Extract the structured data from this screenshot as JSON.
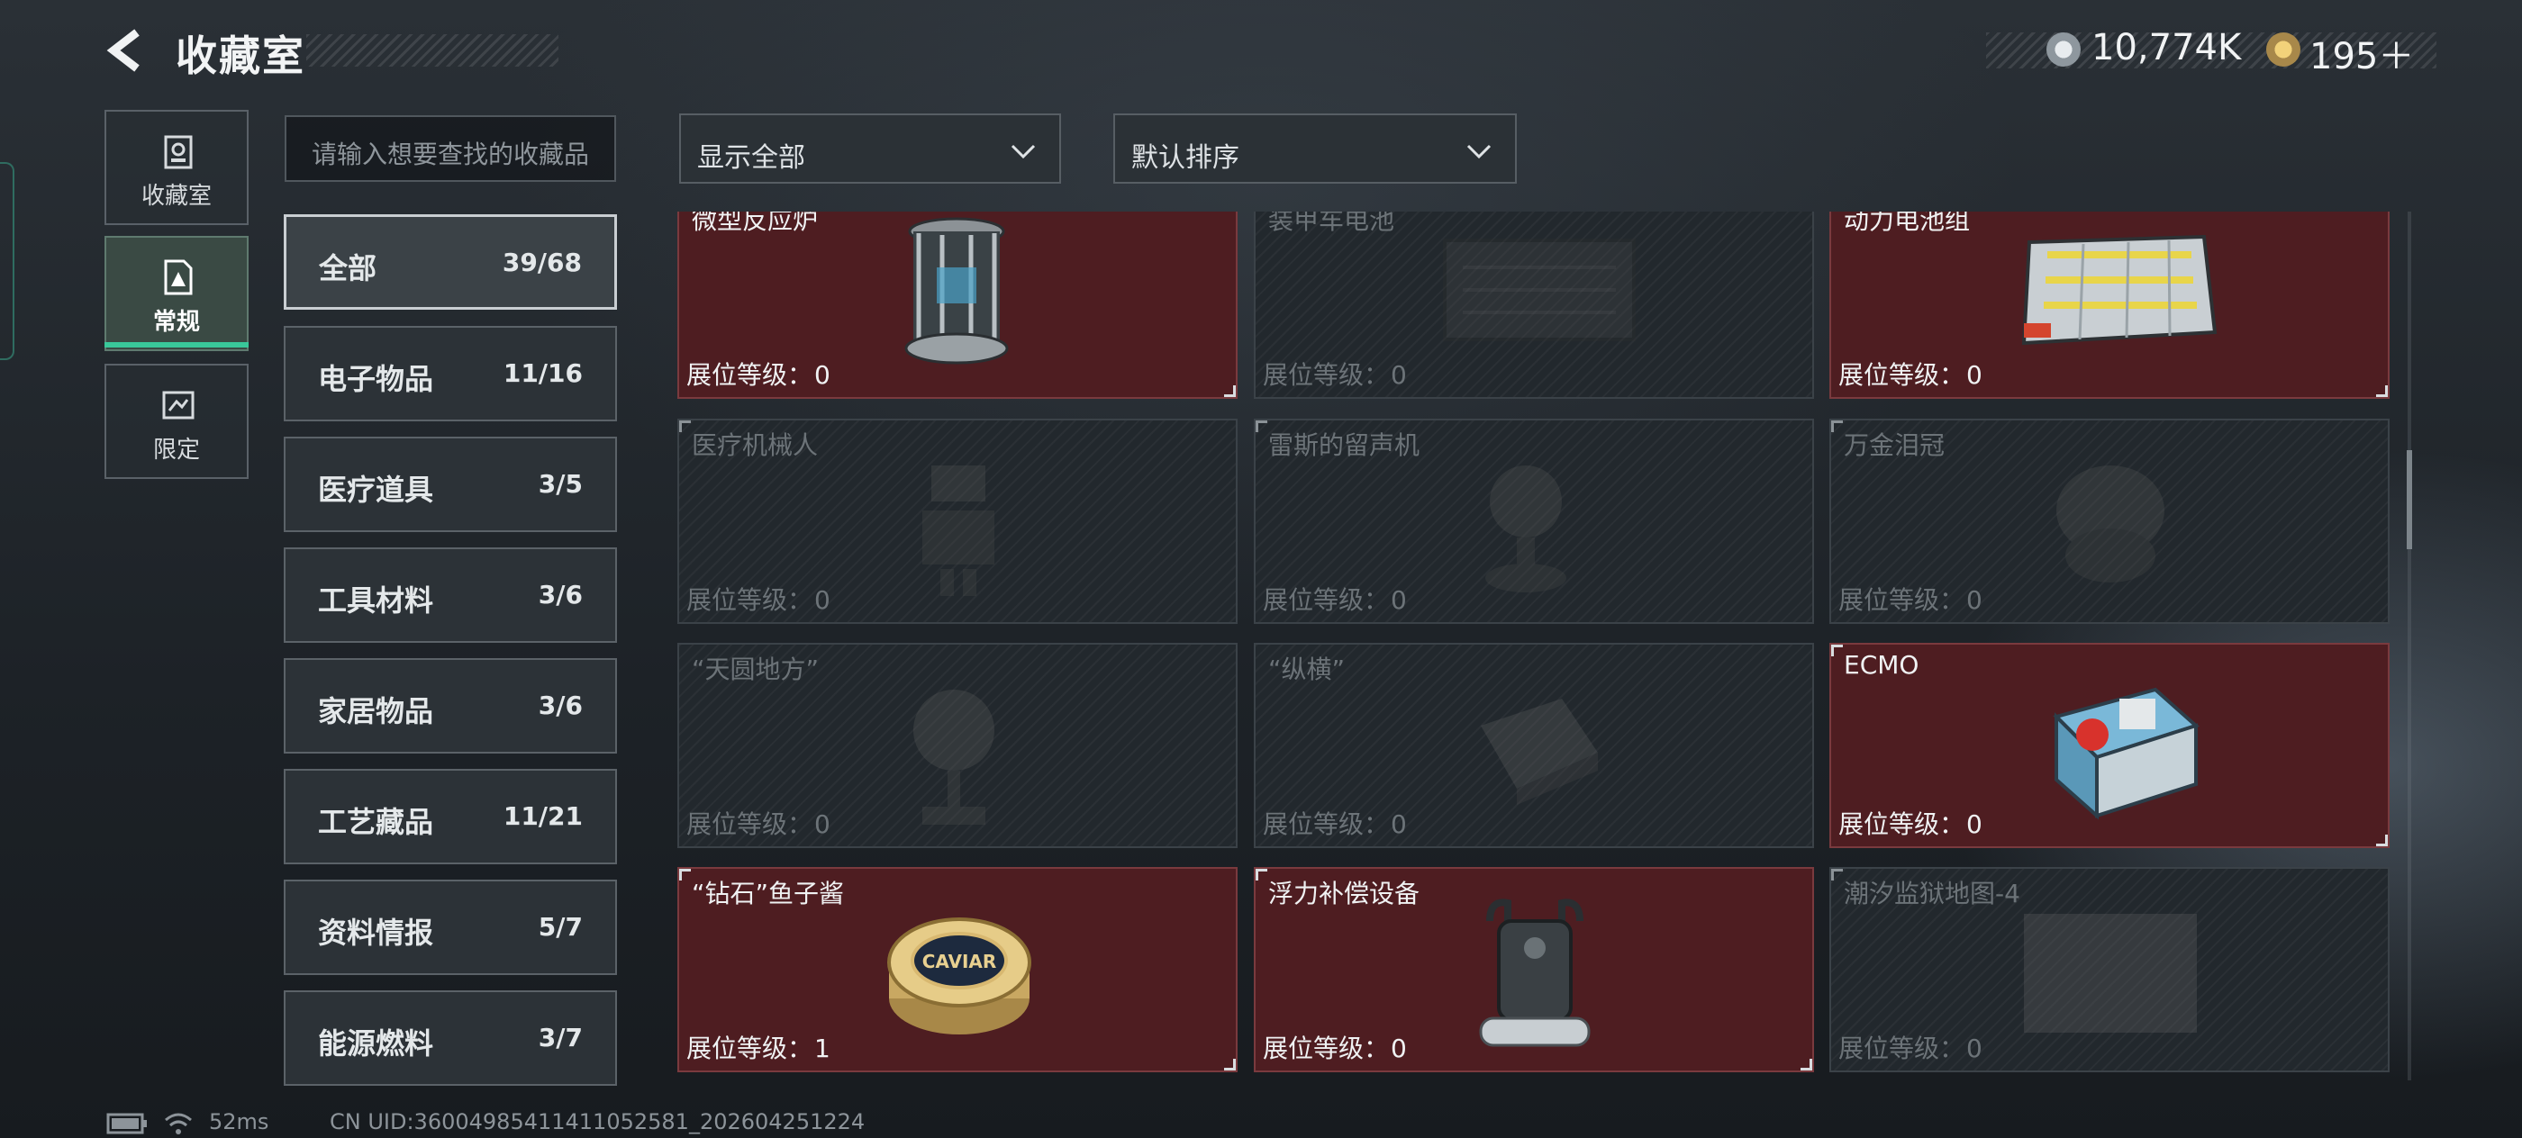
{
  "header": {
    "title": "收藏室",
    "currency": [
      {
        "icon": "coin-icon",
        "value": "10,774K"
      },
      {
        "icon": "gem-icon",
        "value": "195＋"
      }
    ]
  },
  "sidenav": [
    {
      "label": "收藏室",
      "icon": "collection-icon"
    },
    {
      "label": "常规",
      "icon": "regular-icon",
      "active": true
    },
    {
      "label": "限定",
      "icon": "limited-icon"
    }
  ],
  "search": {
    "placeholder": "请输入想要查找的收藏品"
  },
  "filters": {
    "show": "显示全部",
    "sort": "默认排序"
  },
  "categories": [
    {
      "name": "全部",
      "count": "39/68"
    },
    {
      "name": "电子物品",
      "count": "11/16"
    },
    {
      "name": "医疗道具",
      "count": "3/5"
    },
    {
      "name": "工具材料",
      "count": "3/6"
    },
    {
      "name": "家居物品",
      "count": "3/6"
    },
    {
      "name": "工艺藏品",
      "count": "11/21"
    },
    {
      "name": "资料情报",
      "count": "5/7"
    },
    {
      "name": "能源燃料",
      "count": "3/7"
    }
  ],
  "level_label": "展位等级：",
  "items": [
    {
      "name": "微型反应炉",
      "level": "0",
      "owned": true,
      "icon": "reactor-icon"
    },
    {
      "name": "装甲车电池",
      "level": "0",
      "owned": false,
      "icon": "battery-icon"
    },
    {
      "name": "动力电池组",
      "level": "0",
      "owned": true,
      "icon": "power-battery-icon"
    },
    {
      "name": "医疗机械人",
      "level": "0",
      "owned": false,
      "icon": "robot-icon"
    },
    {
      "name": "雷斯的留声机",
      "level": "0",
      "owned": false,
      "icon": "phonograph-icon"
    },
    {
      "name": "万金泪冠",
      "level": "0",
      "owned": false,
      "icon": "crown-icon"
    },
    {
      "name": "“天圆地方”",
      "level": "0",
      "owned": false,
      "icon": "globe-icon"
    },
    {
      "name": "“纵横”",
      "level": "0",
      "owned": false,
      "icon": "chessboard-icon"
    },
    {
      "name": "ECMO",
      "level": "0",
      "owned": true,
      "icon": "ecmo-icon"
    },
    {
      "name": "“钻石”鱼子酱",
      "level": "1",
      "owned": true,
      "icon": "caviar-icon"
    },
    {
      "name": "浮力补偿设备",
      "level": "0",
      "owned": true,
      "icon": "bcd-icon"
    },
    {
      "name": "潮汐监狱地图-4",
      "level": "0",
      "owned": false,
      "icon": "map-icon"
    }
  ],
  "caviar_label": "CAVIAR",
  "footer": {
    "ping": "52ms",
    "uid": "CN UID:36004985411411052581_202604251224"
  }
}
